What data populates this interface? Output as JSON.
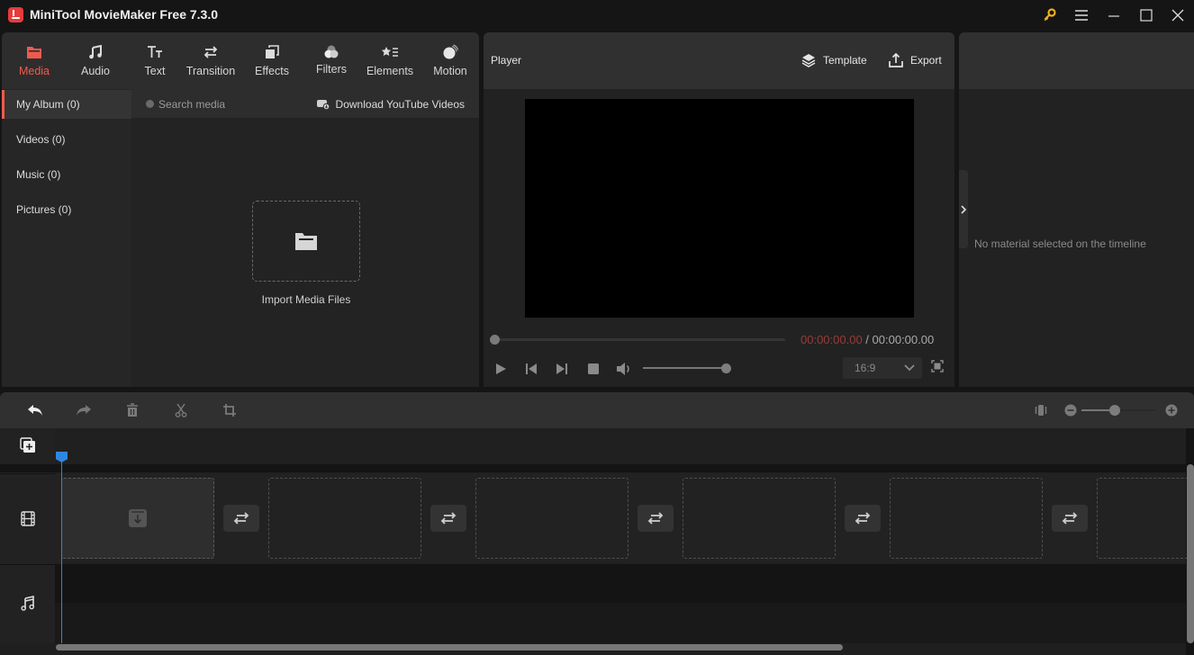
{
  "app": {
    "title": "MiniTool MovieMaker Free 7.3.0",
    "window_controls": [
      "key-icon",
      "menu-icon",
      "minimize-icon",
      "maximize-icon",
      "close-icon"
    ],
    "accent_color": "#f05a4f",
    "key_color": "#f2b01e"
  },
  "media_tabs": [
    {
      "label": "Media",
      "icon": "folder-icon",
      "active": true
    },
    {
      "label": "Audio",
      "icon": "music-icon",
      "active": false
    },
    {
      "label": "Text",
      "icon": "text-icon",
      "active": false
    },
    {
      "label": "Transition",
      "icon": "transition-icon",
      "active": false
    },
    {
      "label": "Effects",
      "icon": "effects-icon",
      "active": false
    },
    {
      "label": "Filters",
      "icon": "filters-icon",
      "active": false
    },
    {
      "label": "Elements",
      "icon": "elements-icon",
      "active": false
    },
    {
      "label": "Motion",
      "icon": "motion-icon",
      "active": false
    }
  ],
  "media_sidebar": [
    {
      "label": "My Album (0)",
      "active": true
    },
    {
      "label": "Videos (0)",
      "active": false
    },
    {
      "label": "Music (0)",
      "active": false
    },
    {
      "label": "Pictures (0)",
      "active": false
    }
  ],
  "search": {
    "placeholder": "Search media",
    "value": ""
  },
  "download_youtube": "Download YouTube Videos",
  "import": {
    "label": "Import Media Files"
  },
  "player": {
    "title": "Player",
    "template_label": "Template",
    "export_label": "Export",
    "current_time": "00:00:00.00",
    "separator": " / ",
    "total_time": "00:00:00.00",
    "progress": 0,
    "volume_percent": 100,
    "aspect_ratio": "16:9",
    "current_time_color": "#9b3b35"
  },
  "properties": {
    "empty_message": "No material selected on the timeline"
  },
  "timeline": {
    "toolbar": [
      "undo-icon",
      "redo-icon",
      "delete-icon",
      "split-icon",
      "crop-icon"
    ],
    "zoom_level": 0.45,
    "tracks": [
      "video-track",
      "audio-track"
    ],
    "clip_slots": 6,
    "playhead_color": "#2f86e0"
  }
}
